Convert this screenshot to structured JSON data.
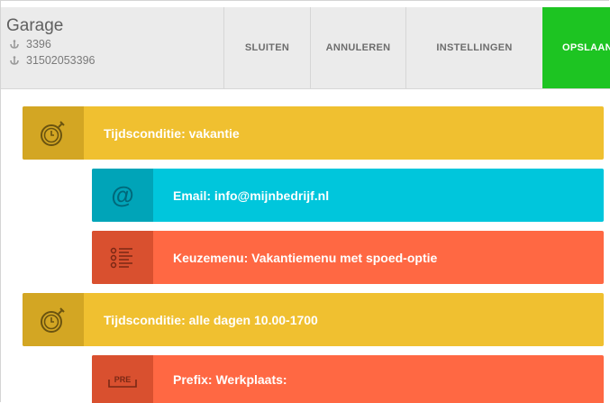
{
  "header": {
    "title": "Garage",
    "number_short": "3396",
    "number_full": "31502053396",
    "buttons": {
      "close": "SLUITEN",
      "cancel": "ANNULEREN",
      "settings": "INSTELLINGEN",
      "save": "OPSLAAN"
    }
  },
  "blocks": [
    {
      "label": "Tijdsconditie: vakantie",
      "icon": "stopwatch-icon",
      "color": "#f0c030"
    },
    {
      "label": "Email: info@mijnbedrijf.nl",
      "icon": "at-sign-icon",
      "color": "#00c6dc"
    },
    {
      "label": "Keuzemenu: Vakantiemenu met spoed-optie",
      "icon": "menu-list-icon",
      "color": "#ff6843"
    },
    {
      "label": "Tijdsconditie: alle dagen 10.00-1700",
      "icon": "stopwatch-icon",
      "color": "#f0c030"
    },
    {
      "label": "Prefix: Werkplaats:",
      "icon": "prefix-icon",
      "icon_text": "PRE",
      "color": "#ff6843"
    }
  ]
}
